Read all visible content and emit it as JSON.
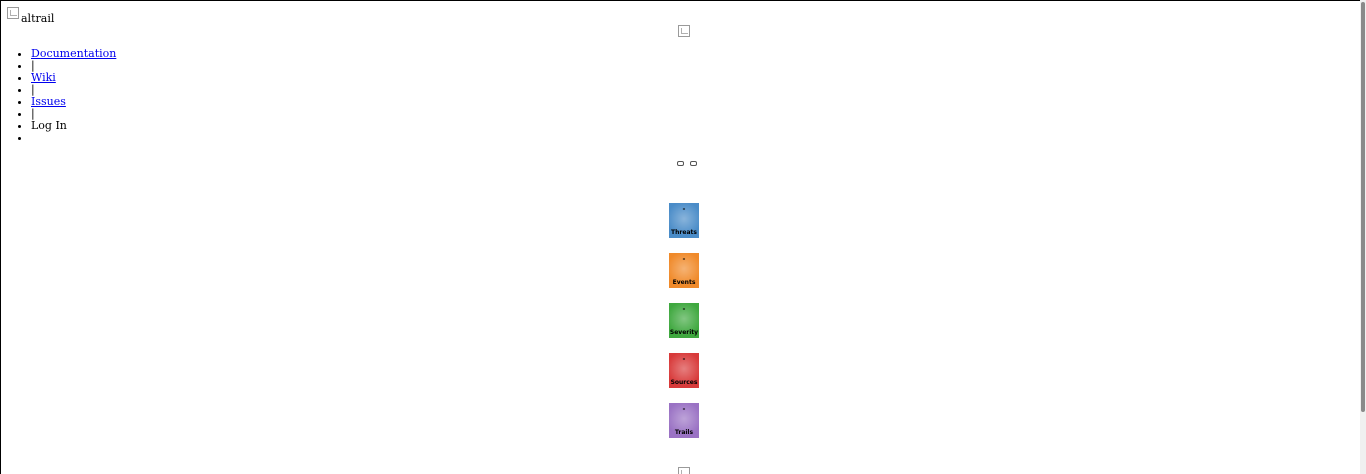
{
  "brand": {
    "name": "altrail"
  },
  "nav": {
    "items": [
      {
        "label": "Documentation"
      },
      {
        "label": "|"
      },
      {
        "label": "Wiki"
      },
      {
        "label": "|"
      },
      {
        "label": "Issues"
      },
      {
        "label": "|"
      },
      {
        "label": "Log In"
      },
      {
        "label": ""
      }
    ]
  },
  "tiles": [
    {
      "label": "Threats",
      "count": "-",
      "color": "#4a8cc8"
    },
    {
      "label": "Events",
      "count": "-",
      "color": "#f08a2a"
    },
    {
      "label": "Severity",
      "count": "-",
      "color": "#3fa83f"
    },
    {
      "label": "Sources",
      "count": "-",
      "color": "#d83a3a"
    },
    {
      "label": "Trails",
      "count": "-",
      "color": "#9a72c4"
    }
  ]
}
